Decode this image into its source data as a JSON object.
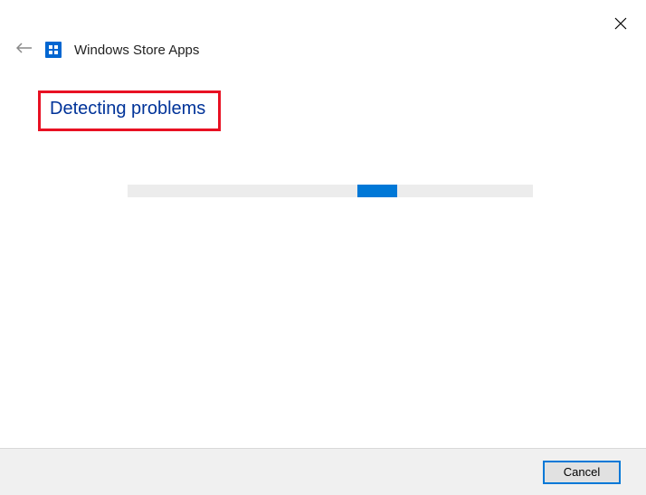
{
  "window": {
    "title": "Windows Store Apps"
  },
  "status": {
    "heading": "Detecting problems"
  },
  "footer": {
    "cancel_label": "Cancel"
  },
  "colors": {
    "accent": "#0078d7",
    "highlight_border": "#e81123",
    "heading_text": "#003399"
  }
}
